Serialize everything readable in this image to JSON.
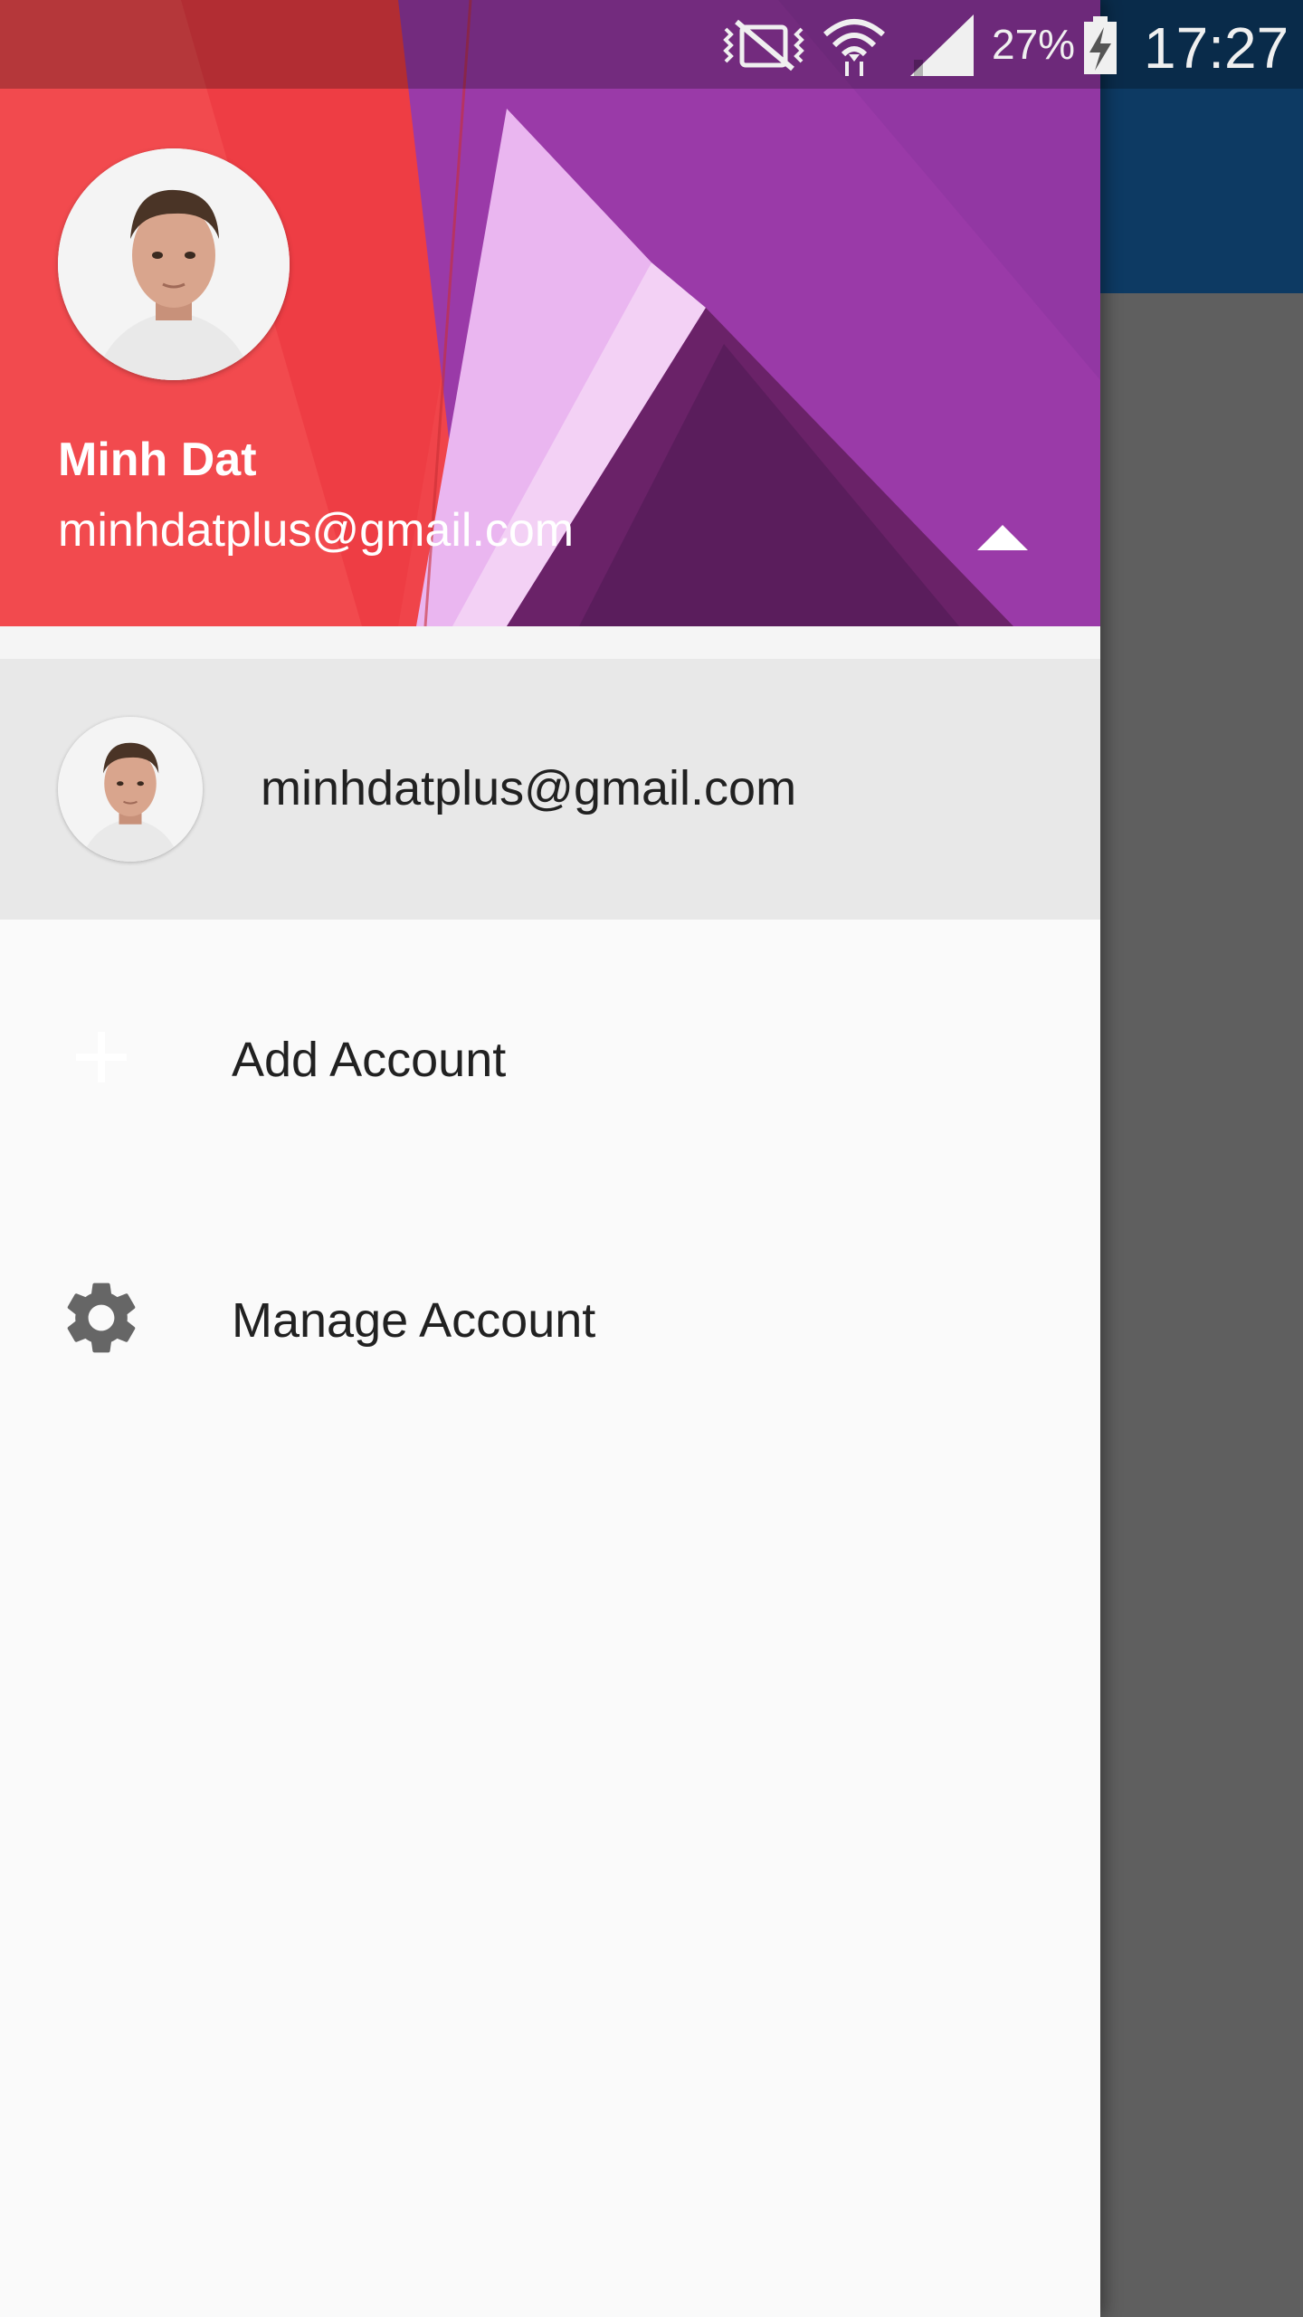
{
  "status_bar": {
    "battery_percent": "27%",
    "time": "17:27",
    "icons": [
      "vibrate-icon",
      "wifi-icon",
      "signal-icon",
      "battery-charging-icon"
    ]
  },
  "drawer_header": {
    "name": "Minh Dat",
    "email": "minhdatplus@gmail.com",
    "toggle_icon": "arrow-up-icon"
  },
  "accounts": [
    {
      "email": "minhdatplus@gmail.com"
    }
  ],
  "menu": {
    "add_account": {
      "label": "Add Account",
      "icon": "plus-icon"
    },
    "manage_account": {
      "label": "Manage Account",
      "icon": "gear-icon"
    }
  },
  "colors": {
    "app_toolbar": "#0d3a63",
    "scrim": "#5f5f5f",
    "header_red": "#f0444a",
    "header_purple": "#9a3aa8",
    "account_row_bg": "#e8e8e8"
  }
}
